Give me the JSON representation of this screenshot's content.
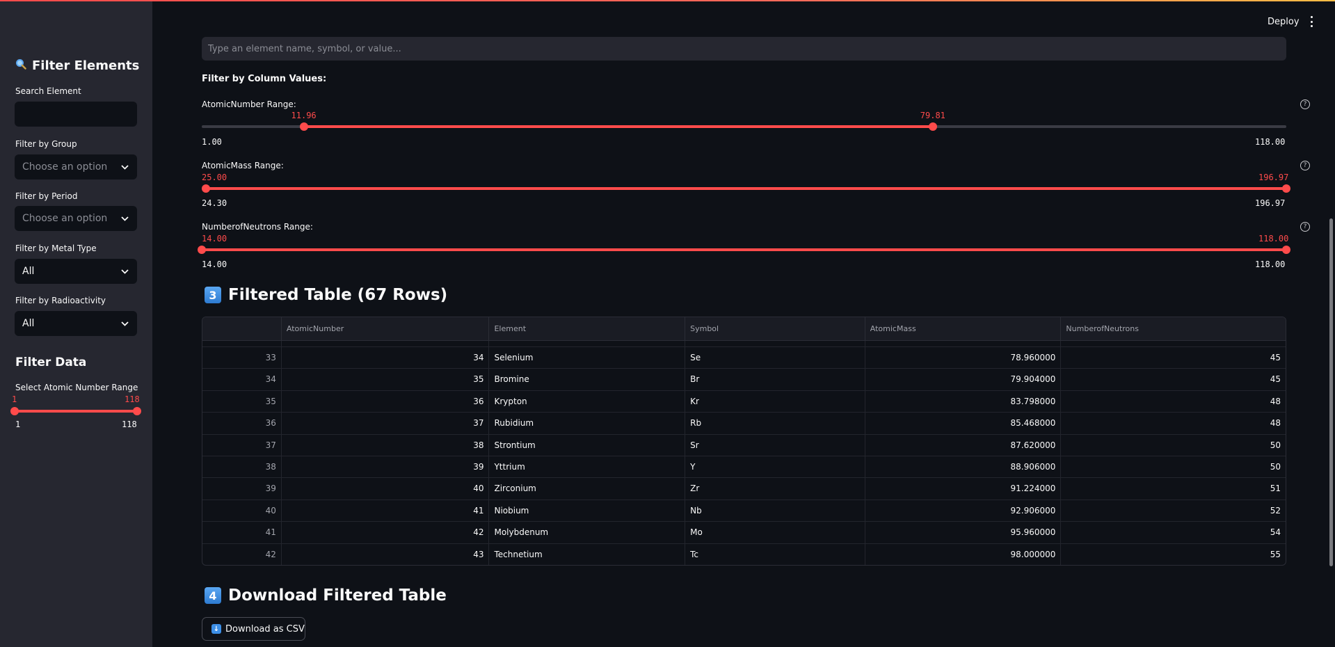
{
  "header": {
    "deploy_label": "Deploy"
  },
  "sidebar": {
    "title": "Filter Elements",
    "search_label": "Search Element",
    "search_value": "",
    "group": {
      "label": "Filter by Group",
      "value": "Choose an option"
    },
    "period": {
      "label": "Filter by Period",
      "value": "Choose an option"
    },
    "metal_type": {
      "label": "Filter by Metal Type",
      "value": "All"
    },
    "radioactivity": {
      "label": "Filter by Radioactivity",
      "value": "All"
    },
    "filter_data_heading": "Filter Data",
    "atomic_range": {
      "label": "Select Atomic Number Range",
      "low": "1",
      "high": "118",
      "min": "1",
      "max": "118"
    }
  },
  "main": {
    "search_placeholder": "Type an element name, symbol, or value...",
    "filter_title": "Filter by Column Values:",
    "ranges": [
      {
        "label": "AtomicNumber Range:",
        "low": "11.96",
        "high": "79.81",
        "min": "1.00",
        "max": "118.00",
        "low_frac": 0.094,
        "high_frac": 0.674
      },
      {
        "label": "AtomicMass Range:",
        "low": "25.00",
        "high": "196.97",
        "min": "24.30",
        "max": "196.97",
        "low_frac": 0.004,
        "high_frac": 1.0
      },
      {
        "label": "NumberofNeutrons Range:",
        "low": "14.00",
        "high": "118.00",
        "min": "14.00",
        "max": "118.00",
        "low_frac": 0.0,
        "high_frac": 1.0
      }
    ],
    "table_section": {
      "number": "3",
      "title": "Filtered Table (67 Rows)"
    },
    "table": {
      "columns": [
        "",
        "AtomicNumber",
        "Element",
        "Symbol",
        "AtomicMass",
        "NumberofNeutrons"
      ],
      "rows": [
        [
          "33",
          "34",
          "Selenium",
          "Se",
          "78.960000",
          "45"
        ],
        [
          "34",
          "35",
          "Bromine",
          "Br",
          "79.904000",
          "45"
        ],
        [
          "35",
          "36",
          "Krypton",
          "Kr",
          "83.798000",
          "48"
        ],
        [
          "36",
          "37",
          "Rubidium",
          "Rb",
          "85.468000",
          "48"
        ],
        [
          "37",
          "38",
          "Strontium",
          "Sr",
          "87.620000",
          "50"
        ],
        [
          "38",
          "39",
          "Yttrium",
          "Y",
          "88.906000",
          "50"
        ],
        [
          "39",
          "40",
          "Zirconium",
          "Zr",
          "91.224000",
          "51"
        ],
        [
          "40",
          "41",
          "Niobium",
          "Nb",
          "92.906000",
          "52"
        ],
        [
          "41",
          "42",
          "Molybdenum",
          "Mo",
          "95.960000",
          "54"
        ],
        [
          "42",
          "43",
          "Technetium",
          "Tc",
          "98.000000",
          "55"
        ]
      ]
    },
    "download_section": {
      "number": "4",
      "title": "Download Filtered Table"
    },
    "download_button": "Download as CSV"
  },
  "colors": {
    "accent": "#ff4b4b",
    "background": "#0e1117",
    "sidebar": "#262730"
  }
}
